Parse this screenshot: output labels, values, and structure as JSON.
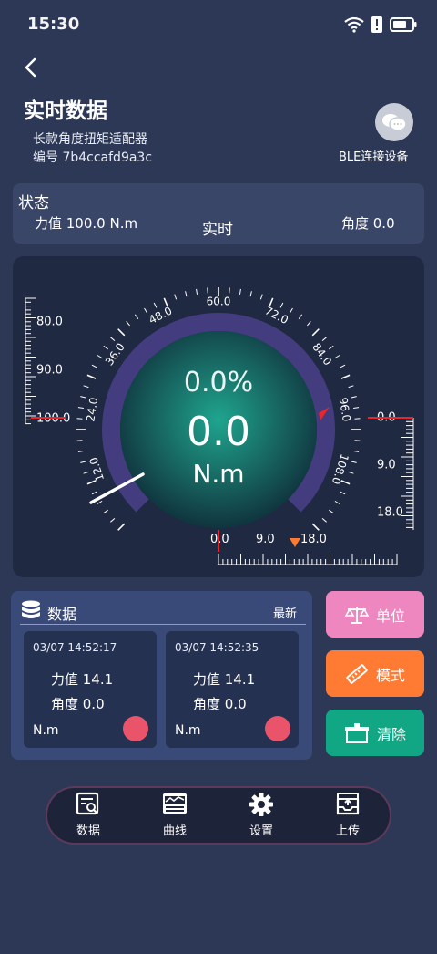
{
  "status_bar": {
    "time": "15:30"
  },
  "header": {
    "title": "实时数据",
    "device_name": "长款角度扭矩适配器",
    "device_id": "编号 7b4ccafd9a3c",
    "ble_label": "BLE连接设备"
  },
  "status": {
    "heading": "状态",
    "force": "力值  100.0 N.m",
    "mode": "实时",
    "angle": "角度  0.0"
  },
  "gauge": {
    "percent": "0.0%",
    "value": "0.0",
    "unit": "N.m",
    "arc_ticks": [
      "12.0",
      "24.0",
      "36.0",
      "48.0",
      "60.0",
      "72.0",
      "84.0",
      "96.0",
      "108.0"
    ],
    "left_scale": [
      "80.0",
      "90.0",
      "100.0"
    ],
    "right_scale": [
      "0.0",
      "9.0",
      "18.0"
    ],
    "bottom_scale": [
      "0.0",
      "9.0",
      "18.0"
    ]
  },
  "data_panel": {
    "title": "数据",
    "latest": "最新",
    "records": [
      {
        "time": "03/07 14:52:17",
        "force": "力值 14.1",
        "angle": "角度 0.0",
        "unit": "N.m"
      },
      {
        "time": "03/07 14:52:35",
        "force": "力值 14.1",
        "angle": "角度 0.0",
        "unit": "N.m"
      }
    ]
  },
  "actions": {
    "unit": "单位",
    "mode": "模式",
    "clear": "清除"
  },
  "nav": {
    "data": "数据",
    "curve": "曲线",
    "settings": "设置",
    "upload": "上传"
  },
  "colors": {
    "background": "#2d3856",
    "gauge_center": "#1fa58f",
    "gauge_arc": "#4a3f8a",
    "unit_button": "#ee86bf",
    "mode_button": "#ff7b33",
    "clear_button": "#11a784",
    "record_dot": "#e9546b",
    "marker_red": "#e8262b"
  }
}
